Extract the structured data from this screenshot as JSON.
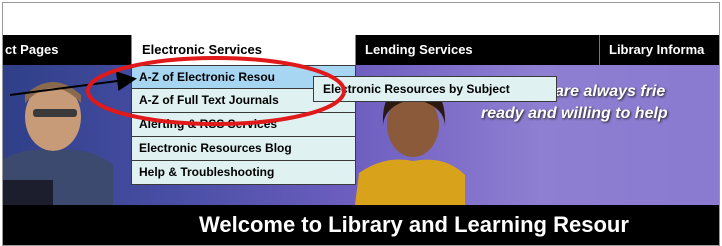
{
  "nav": {
    "items": [
      {
        "label": "ct Pages"
      },
      {
        "label": "Electronic Services"
      },
      {
        "label": "Lending Services"
      },
      {
        "label": "Library Informa"
      }
    ]
  },
  "dropdown": {
    "items": [
      {
        "label": "A-Z of Electronic Resou"
      },
      {
        "label": "A-Z of Full Text Journals"
      },
      {
        "label": "Alerting & RSS Services"
      },
      {
        "label": "Electronic Resources Blog"
      },
      {
        "label": "Help & Troubleshooting"
      }
    ]
  },
  "submenu": {
    "label": "Electronic Resources by Subject"
  },
  "banner": {
    "quote_line1": "\"Library Staff are always frie",
    "quote_line2": "ready and willing to help"
  },
  "welcome": {
    "title": "Welcome to Library and Learning Resour"
  },
  "colors": {
    "nav_background": "#000000",
    "menu_background": "#dff1f1",
    "menu_highlight": "#a7d6f3",
    "annotation_red": "#e0191b"
  }
}
